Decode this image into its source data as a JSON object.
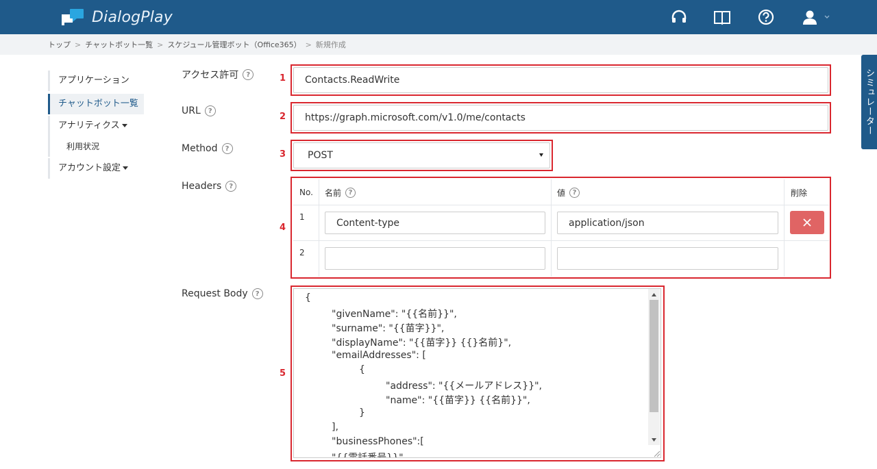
{
  "header": {
    "app_name": "DialogPlay"
  },
  "breadcrumb": {
    "items": [
      "トップ",
      "チャットボット一覧",
      "スケジュール管理ボット（Office365）"
    ],
    "current": "新規作成"
  },
  "sidebar": {
    "items": [
      {
        "label": "アプリケーション"
      },
      {
        "label": "チャットボット一覧"
      },
      {
        "label": "アナリティクス"
      },
      {
        "label": "利用状況"
      },
      {
        "label": "アカウント設定"
      }
    ]
  },
  "form": {
    "access": {
      "label": "アクセス許可",
      "value": "Contacts.ReadWrite",
      "num": "1"
    },
    "url": {
      "label": "URL",
      "value": "https://graph.microsoft.com/v1.0/me/contacts",
      "num": "2"
    },
    "method": {
      "label": "Method",
      "value": "POST",
      "num": "3"
    },
    "headers": {
      "label": "Headers",
      "num": "4",
      "col_no": "No.",
      "col_name": "名前",
      "col_value": "値",
      "col_delete": "削除",
      "rows": [
        {
          "no": "1",
          "name": "Content-type",
          "value": "application/json"
        },
        {
          "no": "2",
          "name": "",
          "value": ""
        }
      ]
    },
    "body": {
      "label": "Request Body",
      "num": "5",
      "lines": [
        "{",
        "\"givenName\": \"{{名前}}\",",
        "\"surname\": \"{{苗字}}\",",
        "\"displayName\": \"{{苗字}} {{}名前}\",",
        "\"emailAddresses\": [",
        "{",
        "\"address\": \"{{メールアドレス}}\",",
        "\"name\": \"{{苗字}} {{名前}}\",",
        "}",
        "],",
        "\"businessPhones\":[",
        "\"{{電話番号}}\""
      ]
    }
  },
  "simulator_tab": "シミュレーター",
  "colors": {
    "topbar": "#1f5a8a",
    "highlight": "#d9262e",
    "delete": "#e06464"
  }
}
